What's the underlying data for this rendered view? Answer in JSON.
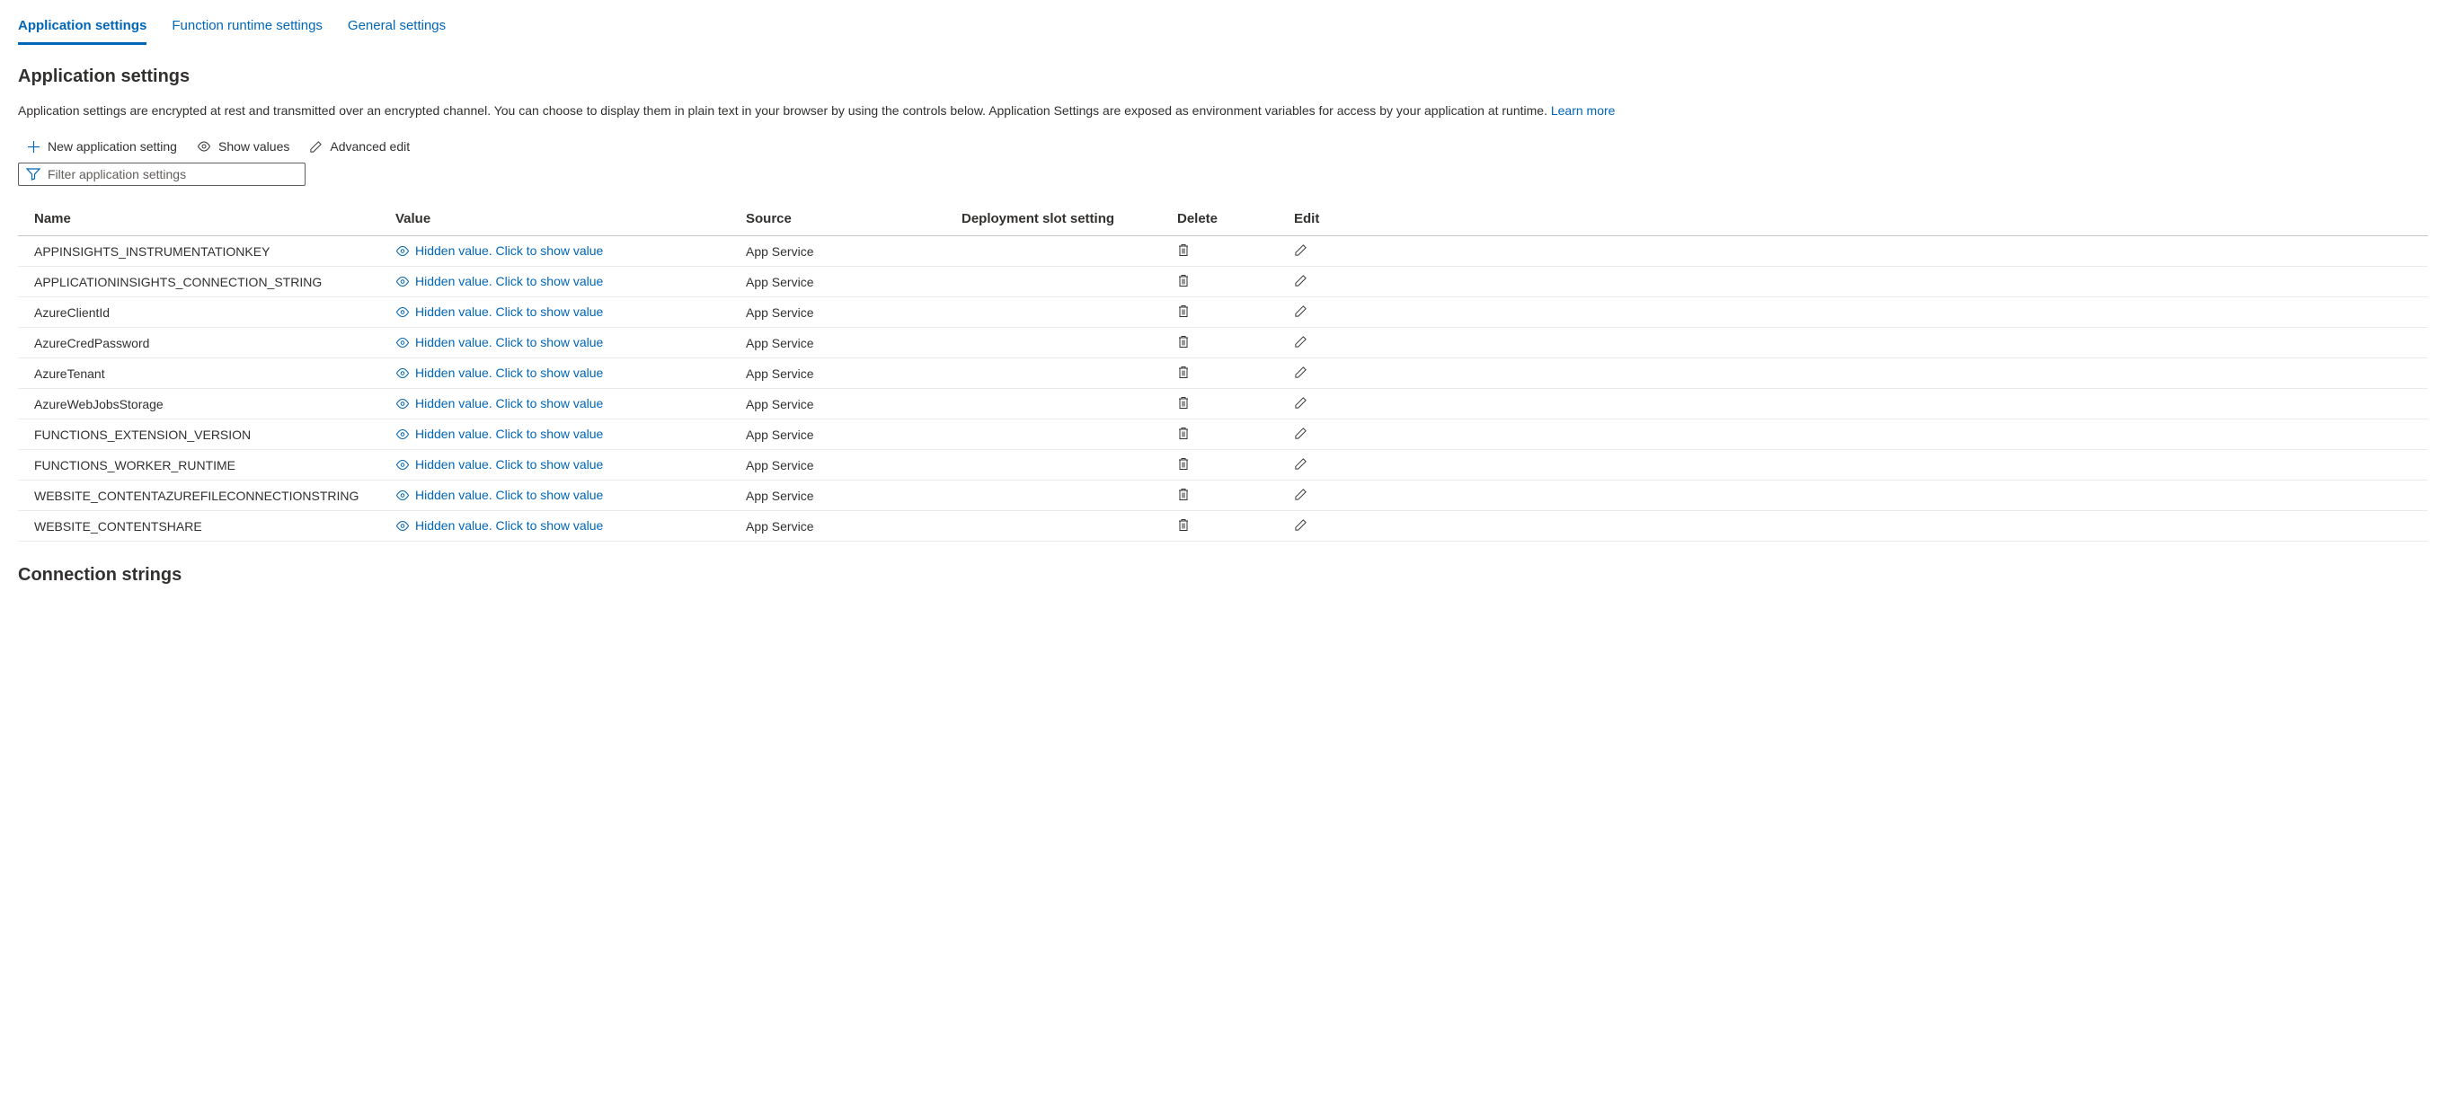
{
  "tabs": [
    {
      "label": "Application settings",
      "active": true
    },
    {
      "label": "Function runtime settings",
      "active": false
    },
    {
      "label": "General settings",
      "active": false
    }
  ],
  "section": {
    "title": "Application settings",
    "description": "Application settings are encrypted at rest and transmitted over an encrypted channel. You can choose to display them in plain text in your browser by using the controls below. Application Settings are exposed as environment variables for access by your application at runtime. ",
    "learn_more": "Learn more"
  },
  "toolbar": {
    "new_setting": "New application setting",
    "show_values": "Show values",
    "advanced_edit": "Advanced edit"
  },
  "filter": {
    "placeholder": "Filter application settings"
  },
  "columns": {
    "name": "Name",
    "value": "Value",
    "source": "Source",
    "slot": "Deployment slot setting",
    "delete": "Delete",
    "edit": "Edit"
  },
  "hidden_value_text": "Hidden value. Click to show value",
  "rows": [
    {
      "name": "APPINSIGHTS_INSTRUMENTATIONKEY",
      "source": "App Service"
    },
    {
      "name": "APPLICATIONINSIGHTS_CONNECTION_STRING",
      "source": "App Service"
    },
    {
      "name": "AzureClientId",
      "source": "App Service"
    },
    {
      "name": "AzureCredPassword",
      "source": "App Service"
    },
    {
      "name": "AzureTenant",
      "source": "App Service"
    },
    {
      "name": "AzureWebJobsStorage",
      "source": "App Service"
    },
    {
      "name": "FUNCTIONS_EXTENSION_VERSION",
      "source": "App Service"
    },
    {
      "name": "FUNCTIONS_WORKER_RUNTIME",
      "source": "App Service"
    },
    {
      "name": "WEBSITE_CONTENTAZUREFILECONNECTIONSTRING",
      "source": "App Service"
    },
    {
      "name": "WEBSITE_CONTENTSHARE",
      "source": "App Service"
    }
  ],
  "section2": {
    "title": "Connection strings"
  }
}
